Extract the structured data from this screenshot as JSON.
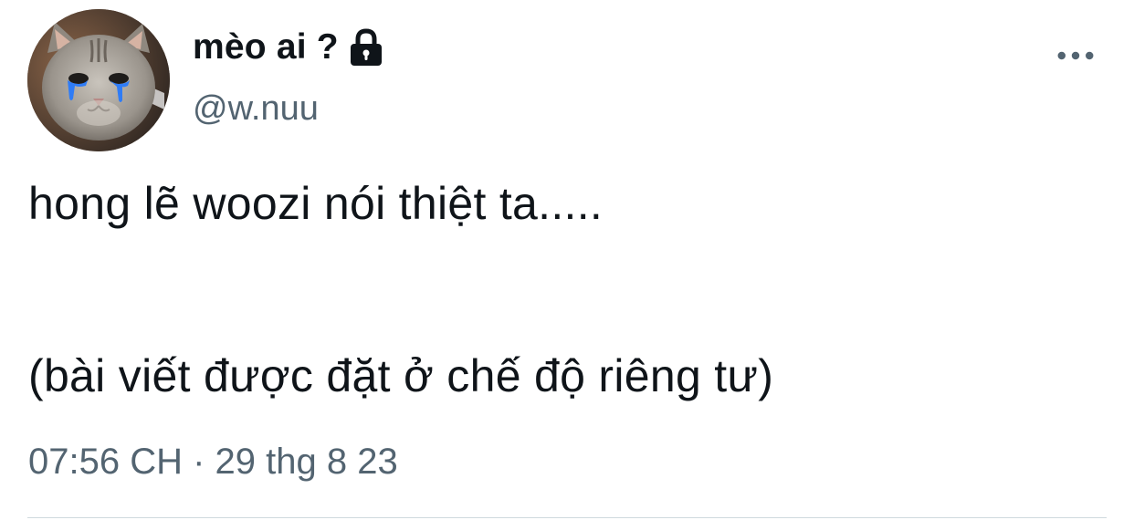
{
  "author": {
    "display_name": "mèo ai ?",
    "handle": "@w.nuu",
    "protected_icon": "lock-icon",
    "avatar": "crying-cat-avatar"
  },
  "tweet": {
    "lines": [
      "hong lẽ woozi nói thiệt ta.....",
      "(bài viết được đặt ở chế độ riêng tư)"
    ]
  },
  "meta": {
    "timestamp": "07:56 CH · 29 thg 8 23"
  },
  "actions": {
    "more_icon": "more-horizontal-icon"
  },
  "colors": {
    "text_primary": "#0f1419",
    "text_secondary": "#536471",
    "divider": "#cfd9de",
    "tears": "#2f7cf6"
  }
}
